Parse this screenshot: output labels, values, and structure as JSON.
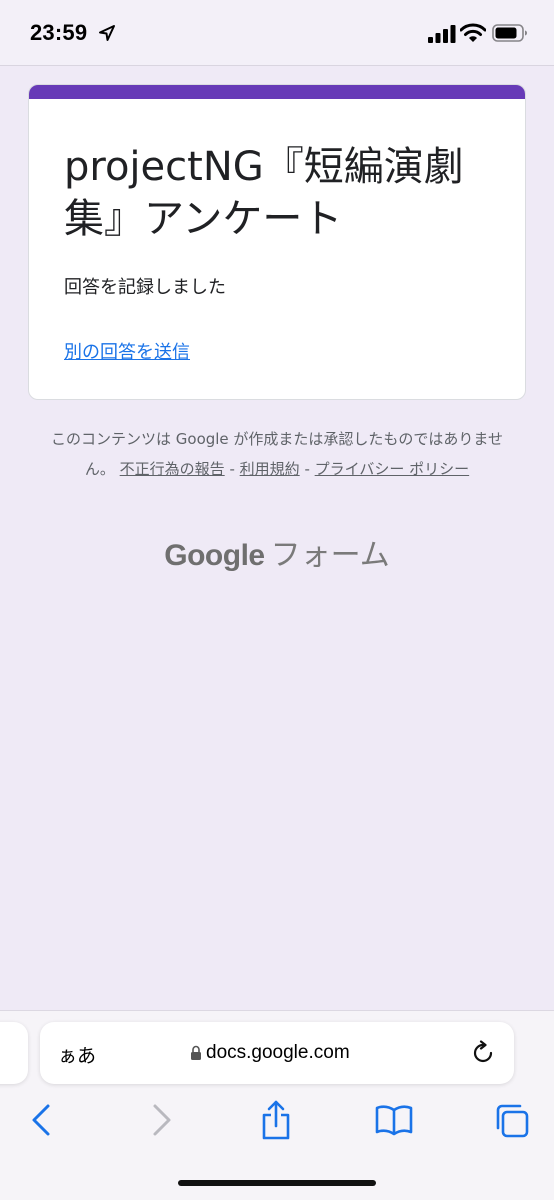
{
  "status_bar": {
    "time": "23:59"
  },
  "form": {
    "title": "projectNG『短編演劇集』アンケート",
    "confirmation": "回答を記録しました",
    "another_response_link": "別の回答を送信",
    "accent_color": "#673ab7"
  },
  "footer": {
    "disclaimer_text": "このコンテンツは Google が作成または承認したものではありません。",
    "link_abuse": "不正行為の報告",
    "link_terms": "利用規約",
    "link_privacy": "プライバシー ポリシー",
    "separator": "-",
    "logo_google": "Google",
    "logo_forms": "フォーム"
  },
  "browser": {
    "aa_label": "ぁあ",
    "url": "docs.google.com",
    "icons": {
      "back": "chevron-left-icon",
      "forward": "chevron-right-icon",
      "share": "share-icon",
      "bookmarks": "book-icon",
      "tabs": "tabs-icon",
      "reload": "reload-icon",
      "lock": "lock-icon"
    },
    "accent_color": "#1a73e8"
  }
}
